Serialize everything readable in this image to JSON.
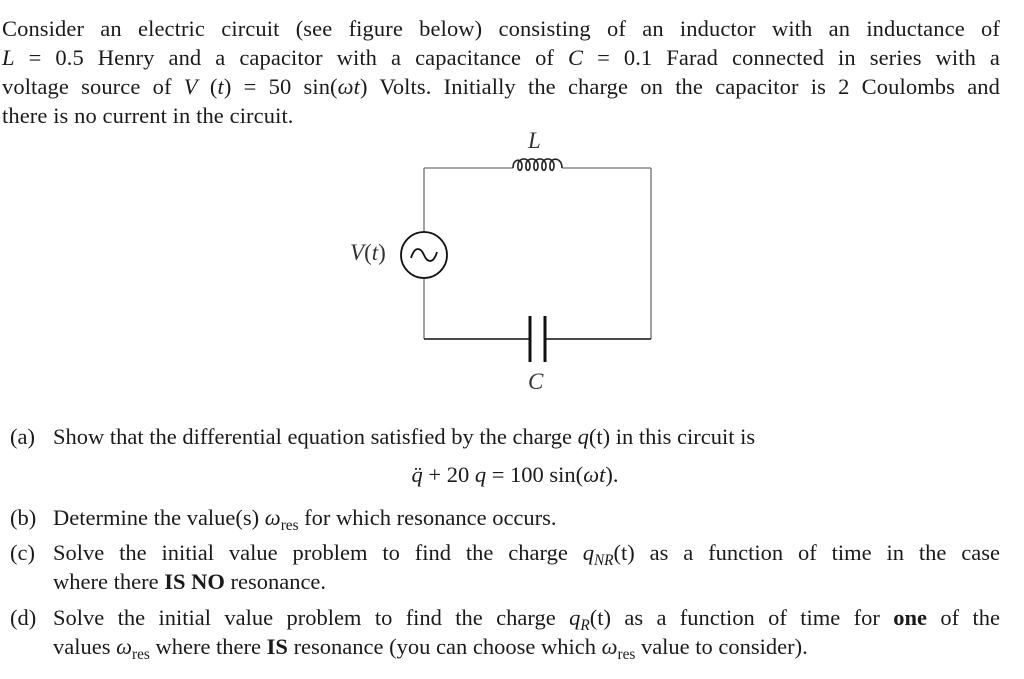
{
  "intro": {
    "line1": "Consider an electric circuit (see figure below) consisting of an inductor with an inductance of",
    "line2_sym_L": "L",
    "line2_eq": " = 0.5 Henry and a capacitor with a capacitance of ",
    "line2_sym_C": "C",
    "line2_rest": " = 0.1 Farad connected in series with a",
    "line3_pre": "voltage source of ",
    "line3_V": "V",
    "line3_paren_open": " (",
    "line3_t": "t",
    "line3_paren_close": ") = 50 sin(",
    "line3_omega_t": "ωt",
    "line3_rest": ") Volts. Initially the charge on the capacitor is 2 Coulombs and",
    "line4": "there is no current in the circuit."
  },
  "circuit": {
    "inductor_label": "L",
    "capacitor_label": "C",
    "source_label_V": "V",
    "source_label_paren": "(t)",
    "source_symbol": "~"
  },
  "parts": [
    {
      "label": "(a)",
      "text_pre": "Show that the differential equation satisfied by the charge ",
      "q": "q",
      "q_arg": "(t)",
      "text_post": " in this circuit is",
      "equation": {
        "lhs_qddot": "q̈",
        "lhs_rest": " + 20 ",
        "lhs_q": "q",
        "rhs": " = 100 sin(",
        "rhs_omega_t": "ωt",
        "rhs_close": ")."
      }
    },
    {
      "label": "(b)",
      "text_pre": "Determine the value(s) ",
      "omega": "ω",
      "omega_sub": "res",
      "text_post": " for which resonance occurs."
    },
    {
      "label": "(c)",
      "line1_pre": "Solve the initial value problem to find the charge ",
      "q": "q",
      "q_sub": "NR",
      "q_arg": "(t)",
      "line1_post": " as a function of time in the case",
      "line2_pre": "where there ",
      "line2_bold": "IS NO",
      "line2_post": " resonance."
    },
    {
      "label": "(d)",
      "line1_pre": "Solve the initial value problem to find the charge ",
      "q": "q",
      "q_sub": "R",
      "q_arg": "(t)",
      "line1_mid": " as a function of time for ",
      "line1_bold": "one",
      "line1_post": " of the",
      "line2_pre": "values ",
      "omega": "ω",
      "omega_sub": "res",
      "line2_mid": " where there ",
      "line2_bold": "IS",
      "line2_mid2": " resonance (you can choose which ",
      "omega2": "ω",
      "omega2_sub": "res",
      "line2_post": " value to consider)."
    }
  ]
}
